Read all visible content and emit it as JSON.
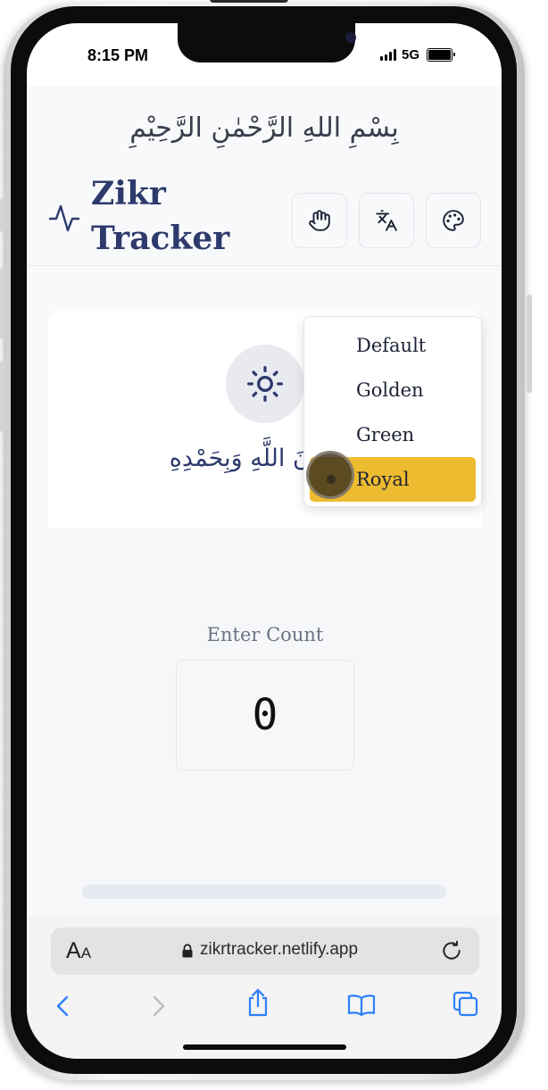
{
  "status_bar": {
    "time": "8:15 PM",
    "network": "5G"
  },
  "app": {
    "bismillah": "بِسْمِ اللهِ الرَّحْمٰنِ الرَّحِيْمِ",
    "title": "Zikr Tracker",
    "header_buttons": [
      {
        "icon": "hand-icon"
      },
      {
        "icon": "translate-icon"
      },
      {
        "icon": "palette-icon"
      }
    ],
    "theme_menu": {
      "items": [
        "Default",
        "Golden",
        "Green",
        "Royal"
      ],
      "selected": "Royal"
    },
    "zikr": {
      "icon": "sun-icon",
      "arabic": "سُبْحَانَ اللَّهِ وَبِحَمْدِهِ"
    },
    "counter": {
      "label": "Enter Count",
      "value": "0",
      "progress": 0.0
    },
    "colors": {
      "primary": "#2d3a6b",
      "selected": "#ecbb2f",
      "background": "#f8f9fb"
    }
  },
  "browser": {
    "text_size_big": "A",
    "text_size_small": "A",
    "url": "zikrtracker.netlify.app",
    "nav_icons": [
      "back-icon",
      "forward-icon",
      "share-icon",
      "bookmarks-icon",
      "tabs-icon"
    ]
  }
}
